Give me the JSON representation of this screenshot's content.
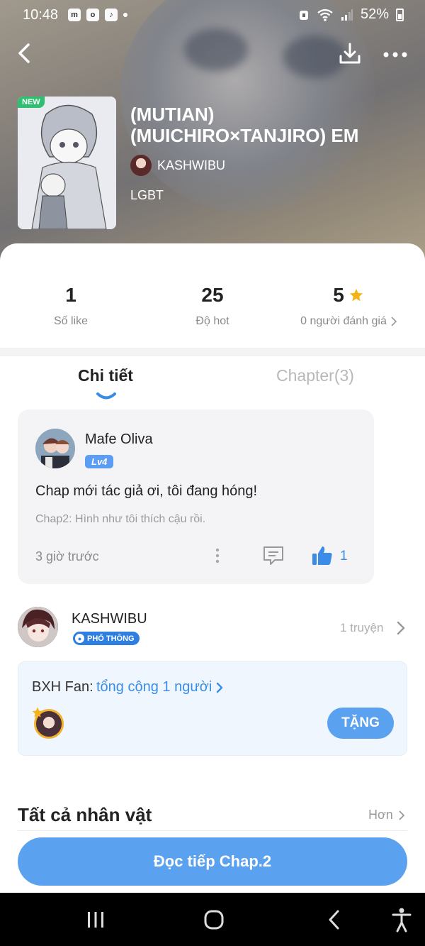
{
  "status_bar": {
    "time": "10:48",
    "battery": "52%",
    "notification_icons": [
      "m",
      "o",
      "♪"
    ]
  },
  "book": {
    "badge": "NEW",
    "title": "(MUTIAN) (MUICHIRO×TANJIRO) EM",
    "author": "KASHWIBU",
    "genre": "LGBT"
  },
  "stats": {
    "likes": {
      "value": "1",
      "label": "Số like"
    },
    "hot": {
      "value": "25",
      "label": "Độ hot"
    },
    "rating": {
      "value": "5",
      "label": "0 người đánh giá"
    }
  },
  "tabs": {
    "detail": "Chi tiết",
    "chapters": "Chapter(3)"
  },
  "comment": {
    "user": "Mafe Oliva",
    "level": "Lv4",
    "text": "Chap mới tác giả ơi, tôi đang hóng!",
    "chapter_ref": "Chap2: Hình như tôi thích cậu rồi.",
    "time": "3 giờ trước",
    "like_count": "1"
  },
  "author_section": {
    "name": "KASHWIBU",
    "badge": "PHỔ THÔNG",
    "works": "1 truyện"
  },
  "fan_ranking": {
    "label": "BXH Fan:",
    "link": "tổng cộng 1 người",
    "gift_button": "TẶNG"
  },
  "characters": {
    "title": "Tất cả nhân vật",
    "more": "Hơn"
  },
  "continue_button": "Đọc tiếp Chap.2",
  "colors": {
    "accent": "#5aa2f0",
    "link": "#3a8de6",
    "star": "#f5b319",
    "new_badge": "#2fbf71"
  }
}
